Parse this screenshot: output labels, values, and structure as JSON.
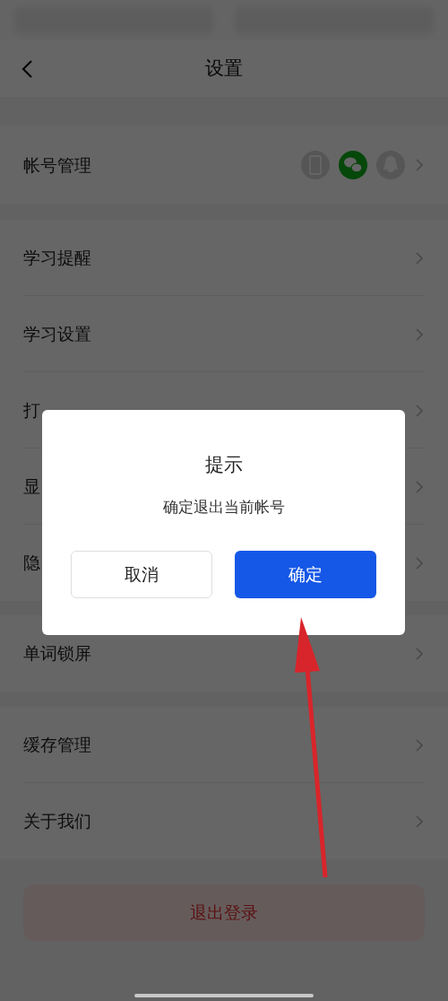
{
  "nav": {
    "title": "设置"
  },
  "sections": [
    {
      "rows": [
        {
          "label": "帐号管理",
          "kind": "accounts",
          "accounts": [
            {
              "kind": "phone",
              "on": false
            },
            {
              "kind": "wechat",
              "on": true
            },
            {
              "kind": "qq",
              "on": false
            }
          ]
        }
      ]
    },
    {
      "rows": [
        {
          "label": "学习提醒",
          "kind": "plain"
        },
        {
          "label": "学习设置",
          "kind": "plain"
        },
        {
          "label": "打",
          "kind": "plain"
        },
        {
          "label": "显",
          "kind": "plain"
        },
        {
          "label": "隐",
          "kind": "plain"
        }
      ]
    },
    {
      "rows": [
        {
          "label": "单词锁屏",
          "kind": "plain"
        }
      ]
    },
    {
      "rows": [
        {
          "label": "缓存管理",
          "kind": "plain"
        },
        {
          "label": "关于我们",
          "kind": "plain"
        }
      ]
    }
  ],
  "logout_button": "退出登录",
  "dialog": {
    "title": "提示",
    "message": "确定退出当前帐号",
    "buttons": [
      {
        "label": "取消",
        "kind": "secondary"
      },
      {
        "label": "确定",
        "kind": "primary"
      }
    ]
  }
}
